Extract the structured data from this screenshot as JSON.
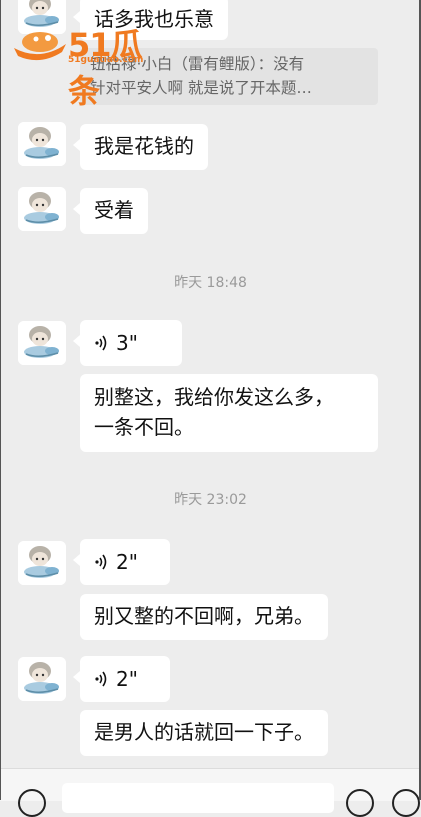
{
  "watermark": {
    "logo_text": "51瓜条",
    "logo_sub": "51guatiao.com"
  },
  "messages": {
    "m1": {
      "text": "话多我也乐意"
    },
    "quote": {
      "line1": "钮祜禄·小白（雷有鲤版）：没有",
      "line2": "针对平安人啊 就是说了开本题…"
    },
    "m2": {
      "text": "我是花钱的"
    },
    "m3": {
      "text": "受着"
    },
    "t1": {
      "time": "昨天 18:48"
    },
    "v1": {
      "duration": "3\""
    },
    "m4": {
      "line1": "别整这，我给你发这么多，",
      "line2": "一条不回。"
    },
    "t2": {
      "time": "昨天 23:02"
    },
    "v2": {
      "duration": "2\""
    },
    "m5": {
      "text": "别又整的不回啊，兄弟。"
    },
    "v3": {
      "duration": "2\""
    },
    "m6": {
      "text": "是男人的话就回一下子。"
    }
  },
  "input_bar": {
    "voice_toggle_icon": "voice-toggle-icon",
    "emoji_icon": "emoji-icon",
    "more_icon": "plus-icon"
  },
  "colors": {
    "background": "#ededed",
    "bubble": "#ffffff",
    "accent": "#f07a20"
  }
}
